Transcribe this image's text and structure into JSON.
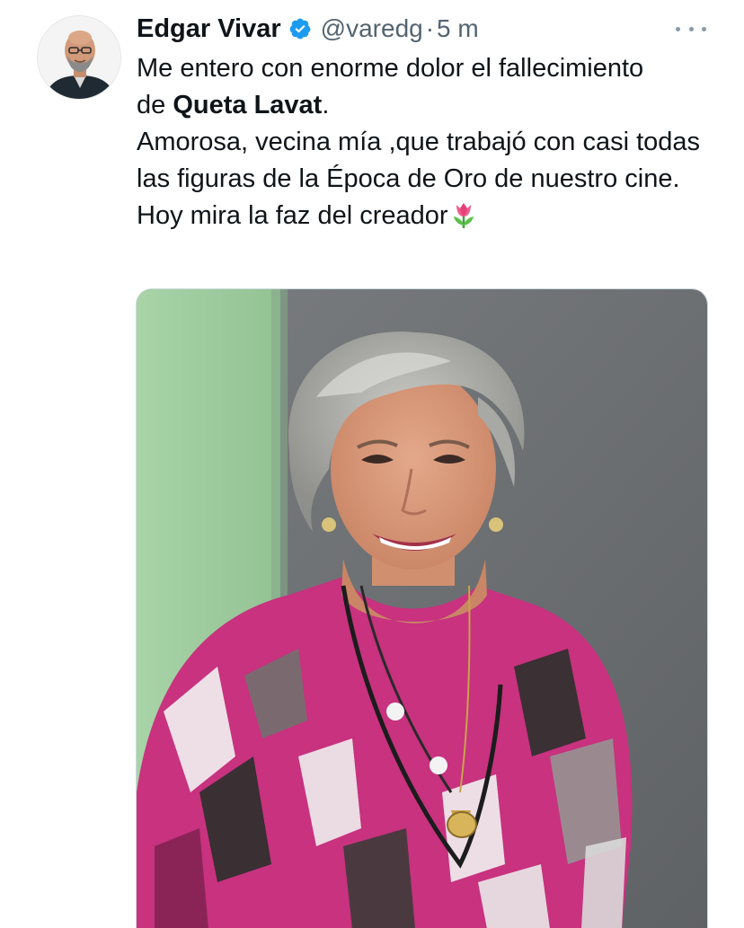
{
  "tweet": {
    "author": {
      "name": "Edgar Vivar",
      "handle": "@varedg",
      "verified": true,
      "avatar_icon": "profile-photo"
    },
    "separator": "·",
    "time": "5 m",
    "more_icon": "more-horizontal-icon",
    "text": {
      "line1": "Me entero con enorme dolor el fallecimiento",
      "line2_prefix": "de ",
      "line2_bold": "Queta Lavat",
      "line2_suffix": ".",
      "paragraph2": "Amorosa, vecina mía ,que trabajó con casi todas las figuras de la Época de Oro de nuestro cine.",
      "paragraph3": "Hoy mira la faz del creador",
      "emoji": "tulip-emoji"
    },
    "media": {
      "type": "photo"
    }
  },
  "colors": {
    "text_primary": "#0f1419",
    "text_secondary": "#536471",
    "verified_blue": "#1d9bf0",
    "photo_green_wall": "#9fcc9f",
    "photo_gray_wall": "#6f7275",
    "blouse_pink": "#c8327f"
  }
}
